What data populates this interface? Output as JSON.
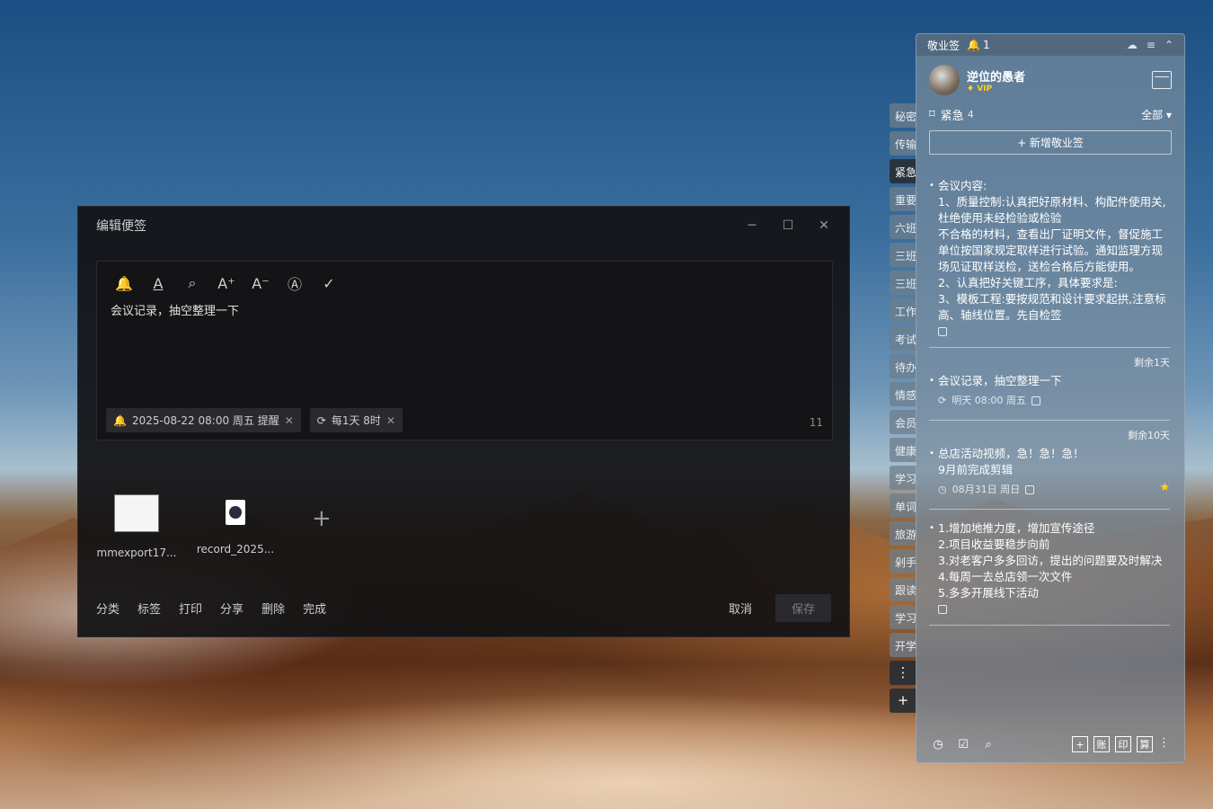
{
  "editor": {
    "title": "编辑便签",
    "window_buttons": [
      "─",
      "☐",
      "✕"
    ],
    "toolbar_icons": [
      "bell-icon",
      "text-color-icon",
      "search-icon",
      "font-increase-icon",
      "font-decrease-icon",
      "font-style-icon",
      "check-icon"
    ],
    "toolbar_glyphs": [
      "🔔",
      "A",
      "⌕",
      "A⁺",
      "A⁻",
      "Ⓐ",
      "✓"
    ],
    "content": "会议记录，抽空整理一下",
    "reminder_chip": "2025-08-22 08:00 周五 提醒",
    "repeat_chip": "每1天 8时",
    "char_count": "11",
    "attachments": [
      {
        "name": "mmexport17..."
      },
      {
        "name": "record_2025..."
      }
    ],
    "footer_actions": [
      "分类",
      "标签",
      "打印",
      "分享",
      "删除",
      "完成"
    ],
    "cancel_label": "取消",
    "save_label": "保存"
  },
  "side_tabs": [
    "秘密",
    "传输",
    "紧急",
    "重要",
    "六班",
    "三班",
    "三班",
    "工作",
    "考试",
    "待办",
    "情感",
    "会员",
    "健康",
    "学习",
    "单词",
    "旅游",
    "剁手",
    "跟读",
    "学习",
    "开学"
  ],
  "side_tab_active": 2,
  "side_tab_more": "⋮",
  "side_tab_add": "+",
  "panel": {
    "app_name": "敬业签",
    "notify_count": "1",
    "user_name": "逆位的愚者",
    "vip_label": "VIP",
    "category": "紧急",
    "category_count": "4",
    "filter_all": "全部",
    "add_label": "+ 新增敬业签",
    "notes": [
      {
        "remain": "",
        "text": "会议内容:\n1、质量控制:认真把好原材料、构配件使用关,杜绝使用未经检验或检验\n不合格的材料，查看出厂证明文件，督促施工单位按国家规定取样进行试验。通知监理方现场见证取样送检，送检合格后方能使用。\n2、认真把好关键工序，具体要求是:\n3、模板工程:要按规范和设计要求起拱,注意标高、轴线位置。先自检签",
        "meta": ""
      },
      {
        "remain": "剩余1天",
        "text": "会议记录，抽空整理一下",
        "meta": "明天 08:00 周五"
      },
      {
        "remain": "剩余10天",
        "text": "总店活动视频，急！急！急！\n9月前完成剪辑",
        "meta": "08月31日 周日"
      },
      {
        "remain": "",
        "text": "1.增加地推力度，增加宣传途径\n2.项目收益要稳步向前\n3.对老客户多多回访，提出的问题要及时解决\n4.每周一去总店领一次文件\n5.多多开展线下活动",
        "meta": ""
      }
    ],
    "footer_boxes": [
      "+",
      "账",
      "印",
      "算"
    ]
  }
}
